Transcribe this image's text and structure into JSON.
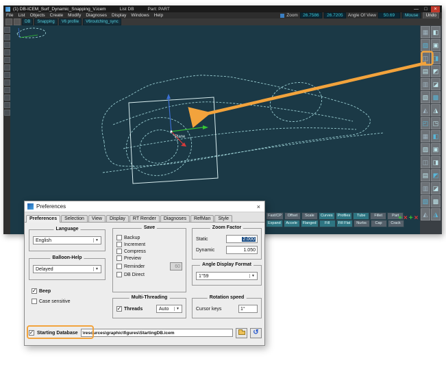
{
  "colors": {
    "accent_orange": "#F2A33C",
    "viewport_bg": "#1B3946",
    "wireframe": "#9FD4D8",
    "field_teal": "#3AC8D8"
  },
  "titlebar": {
    "title": "(1) DB-ICEM_Surf_Dynamic_Snapping_V.icem",
    "list": "List DB",
    "part": "Part: PART",
    "controls": {
      "minimize": "—",
      "maximize": "□",
      "close": "×"
    }
  },
  "menubar": {
    "items": [
      "File",
      "List",
      "Objects",
      "Create",
      "Modify",
      "Diagnoses",
      "Display",
      "Windows",
      "Help"
    ],
    "zoom_label": "Zoom",
    "zoom_static": "26.7586",
    "zoom_dynamic": "26.7205",
    "angle_label": "Angle Of View",
    "angle_value": "50.69",
    "mouse": "Mouse",
    "undo": "Undo"
  },
  "toolbar": {
    "items": [
      "DB",
      "Snapping",
      "V6 profile",
      "V6routching_sync"
    ]
  },
  "left_toolbar": {
    "button_count": 12
  },
  "right_toolbar": {
    "columns": 2,
    "rows": 15
  },
  "viewport": {
    "plane_label": "Plane"
  },
  "bottom_toolbar": {
    "row1": [
      "Fast/CP",
      "Offset",
      "Scale",
      "Curves",
      "Profiles",
      "Tube",
      "Fillet",
      "Part"
    ],
    "row2": [
      "Expand",
      "Accele",
      "Flanged",
      "Fill",
      "Fill Flat",
      "Nurbs",
      "Cap",
      "Crack"
    ]
  },
  "dialog": {
    "title": "Preferences",
    "close": "×",
    "tabs": [
      "Preferences",
      "Selection",
      "View",
      "Display",
      "RT Render",
      "Diagnoses",
      "RefMan",
      "Style"
    ],
    "language": {
      "label": "Language",
      "value": "English"
    },
    "balloon_help": {
      "label": "Balloon-Help",
      "value": "Delayed"
    },
    "beep_label": "Beep",
    "case_sensitive_label": "Case sensitive",
    "save": {
      "label": "Save",
      "options": [
        "Backup",
        "Increment",
        "Compress",
        "Preview",
        "Reminder",
        "DB Direct"
      ],
      "reminder_value": "60"
    },
    "multi_threading": {
      "label": "Multi-Threading",
      "threads_label": "Threads",
      "mode_value": "Auto"
    },
    "zoom_factor": {
      "label": "Zoom Factor",
      "static_label": "Static",
      "static_value": "2.000",
      "dynamic_label": "Dynamic",
      "dynamic_value": "1.050"
    },
    "angle_display": {
      "label": "Angle Display Format",
      "value": "1°59"
    },
    "rotation_speed": {
      "label": "Rotation speed",
      "cursor_label": "Cursor keys",
      "value": "1°"
    },
    "starting_database": {
      "label": "Starting Database",
      "path": "\\resources\\graphic\\figures\\StartingDB.icem"
    }
  }
}
